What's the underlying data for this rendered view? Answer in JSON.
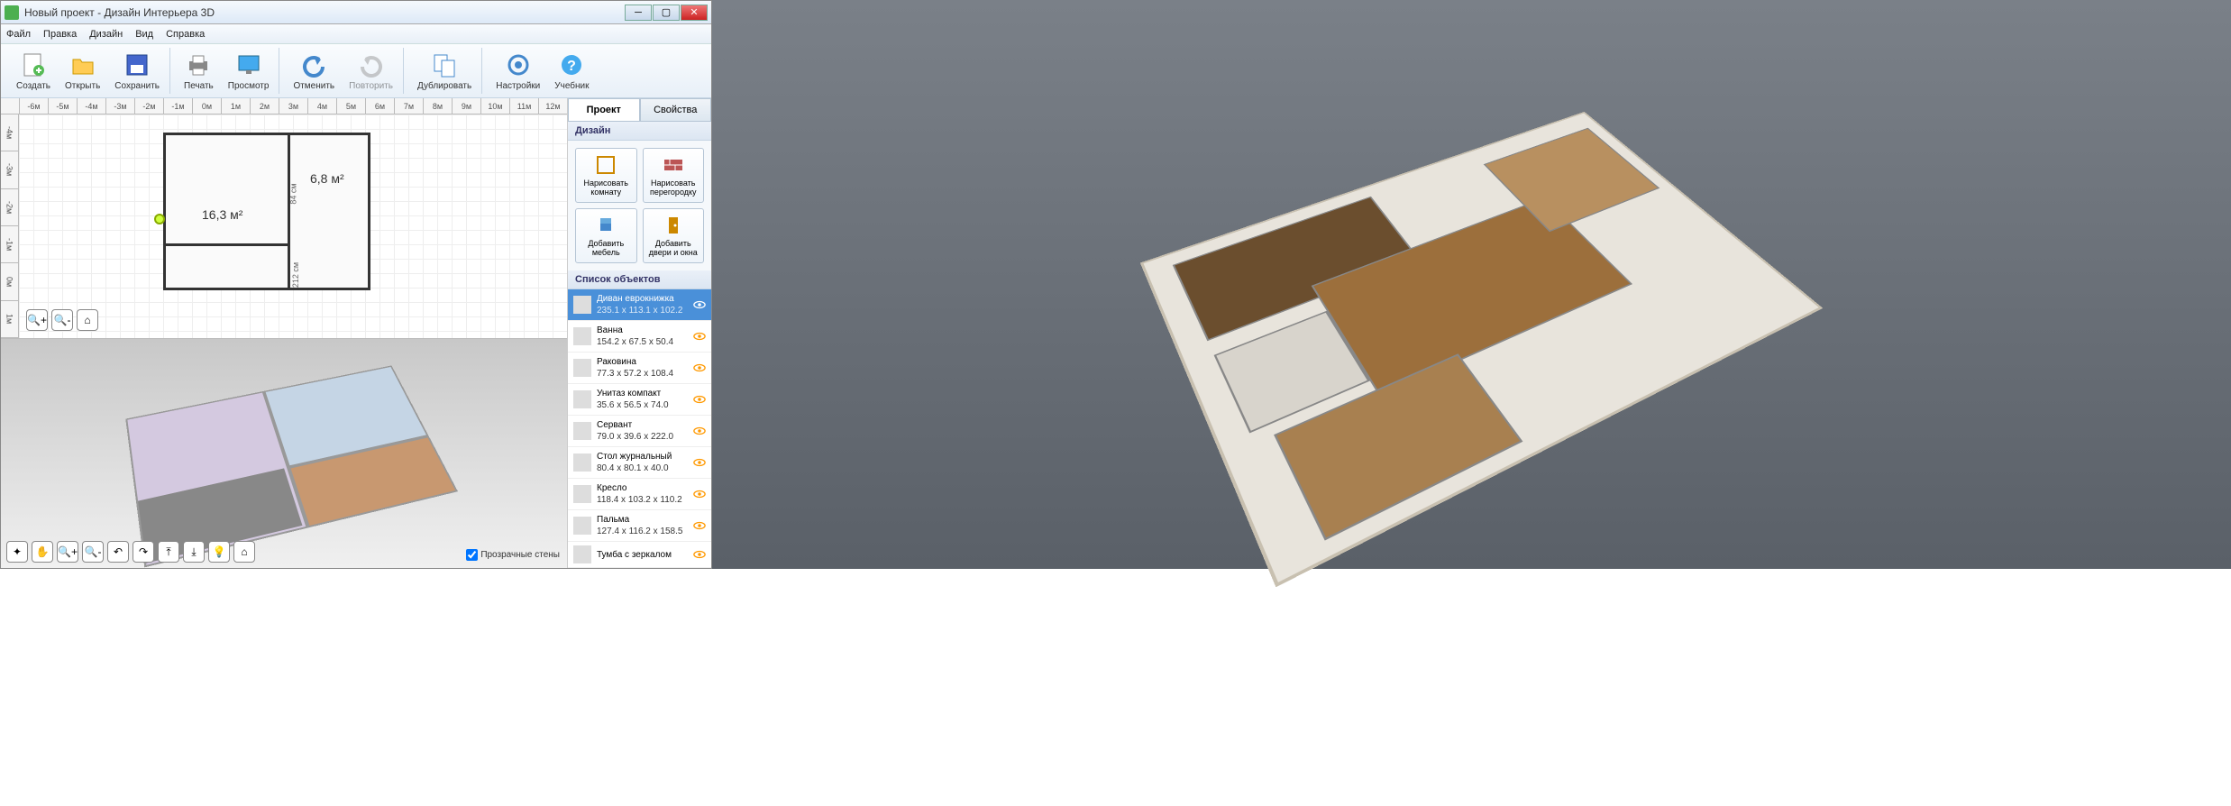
{
  "titlebar": {
    "title": "Новый проект - Дизайн Интерьера 3D"
  },
  "menu": {
    "file": "Файл",
    "edit": "Правка",
    "design": "Дизайн",
    "view": "Вид",
    "help": "Справка"
  },
  "toolbar": {
    "create": "Создать",
    "open": "Открыть",
    "save": "Сохранить",
    "print": "Печать",
    "preview": "Просмотр",
    "undo": "Отменить",
    "redo": "Повторить",
    "duplicate": "Дублировать",
    "settings": "Настройки",
    "tutorial": "Учебник"
  },
  "ruler": {
    "marks": [
      "-6м",
      "-5м",
      "-4м",
      "-3м",
      "-2м",
      "-1м",
      "0м",
      "1м",
      "2м",
      "3м",
      "4м",
      "5м",
      "6м",
      "7м",
      "8м",
      "9м",
      "10м",
      "11м",
      "12м"
    ]
  },
  "rulerV": {
    "marks": [
      "-4м",
      "-3м",
      "-2м",
      "-1м",
      "0м",
      "1м"
    ]
  },
  "plan": {
    "area1": "16,3 м²",
    "area2": "6,8 м²",
    "dim1": "84 см",
    "dim2": "212 см"
  },
  "transparent": "Прозрачные стены",
  "tabs": {
    "project": "Проект",
    "properties": "Свойства"
  },
  "sections": {
    "design": "Дизайн",
    "objects": "Список объектов"
  },
  "designBtns": {
    "drawRoom": "Нарисовать комнату",
    "drawWall": "Нарисовать перегородку",
    "addFurn": "Добавить мебель",
    "addDoor": "Добавить двери и окна"
  },
  "objects": [
    {
      "name": "Диван еврокнижка",
      "dim": "235.1 x 113.1 x 102.2"
    },
    {
      "name": "Ванна",
      "dim": "154.2 x 67.5 x 50.4"
    },
    {
      "name": "Раковина",
      "dim": "77.3 x 57.2 x 108.4"
    },
    {
      "name": "Унитаз компакт",
      "dim": "35.6 x 56.5 x 74.0"
    },
    {
      "name": "Сервант",
      "dim": "79.0 x 39.6 x 222.0"
    },
    {
      "name": "Стол журнальный",
      "dim": "80.4 x 80.1 x 40.0"
    },
    {
      "name": "Кресло",
      "dim": "118.4 x 103.2 x 110.2"
    },
    {
      "name": "Пальма",
      "dim": "127.4 x 116.2 x 158.5"
    },
    {
      "name": "Тумба с зеркалом",
      "dim": ""
    }
  ]
}
